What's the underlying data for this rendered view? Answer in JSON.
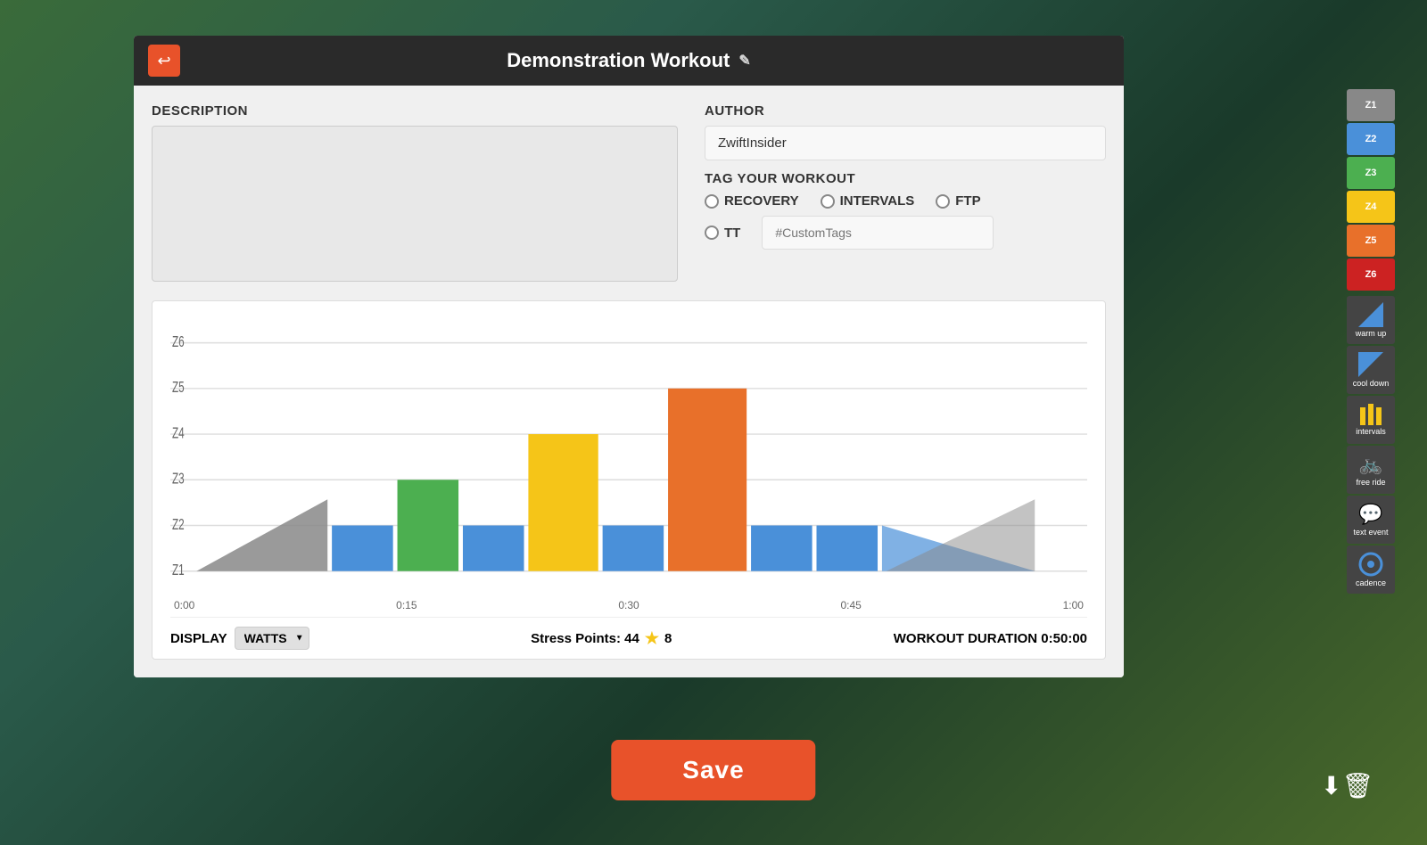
{
  "title_bar": {
    "back_label": "←",
    "title": "Demonstration Workout",
    "edit_icon": "✎"
  },
  "description": {
    "label": "DESCRIPTION",
    "placeholder": ""
  },
  "author": {
    "label": "AUTHOR",
    "value": "ZwiftInsider"
  },
  "tags": {
    "label": "TAG YOUR WORKOUT",
    "options": [
      {
        "id": "recovery",
        "label": "RECOVERY"
      },
      {
        "id": "intervals",
        "label": "INTERVALS"
      },
      {
        "id": "ftp",
        "label": "FTP"
      },
      {
        "id": "tt",
        "label": "TT"
      }
    ],
    "custom_placeholder": "#CustomTags"
  },
  "bottom_bar": {
    "display_label": "DISPLAY",
    "watts_value": "WATTS",
    "stress_label": "Stress Points: 44",
    "rating": "8",
    "duration_label": "WORKOUT DURATION",
    "duration_value": "0:50:00"
  },
  "time_axis": [
    "0:00",
    "0:15",
    "0:30",
    "0:45",
    "1:00"
  ],
  "zone_labels": [
    "Z6",
    "Z5",
    "Z4",
    "Z3",
    "Z2",
    "Z1"
  ],
  "right_panel": {
    "zones": [
      {
        "id": "z1",
        "label": "Z1",
        "color": "#888888"
      },
      {
        "id": "z2",
        "label": "Z2",
        "color": "#4a90d9"
      },
      {
        "id": "z3",
        "label": "Z3",
        "color": "#4caf50"
      },
      {
        "id": "z4",
        "label": "Z4",
        "color": "#f5c518"
      },
      {
        "id": "z5",
        "label": "Z5",
        "color": "#e8702a"
      },
      {
        "id": "z6",
        "label": "Z6",
        "color": "#cc2222"
      }
    ],
    "tools": [
      {
        "id": "warm-up",
        "label": "warm up",
        "icon": "▲"
      },
      {
        "id": "cool-down",
        "label": "cool down",
        "icon": "▼"
      },
      {
        "id": "intervals",
        "label": "intervals",
        "icon": "|||"
      },
      {
        "id": "free-ride",
        "label": "free ride",
        "icon": "🚲"
      },
      {
        "id": "text-event",
        "label": "text event",
        "icon": "💬"
      },
      {
        "id": "cadence",
        "label": "cadence",
        "icon": "◎"
      }
    ]
  },
  "save_button": "Save"
}
